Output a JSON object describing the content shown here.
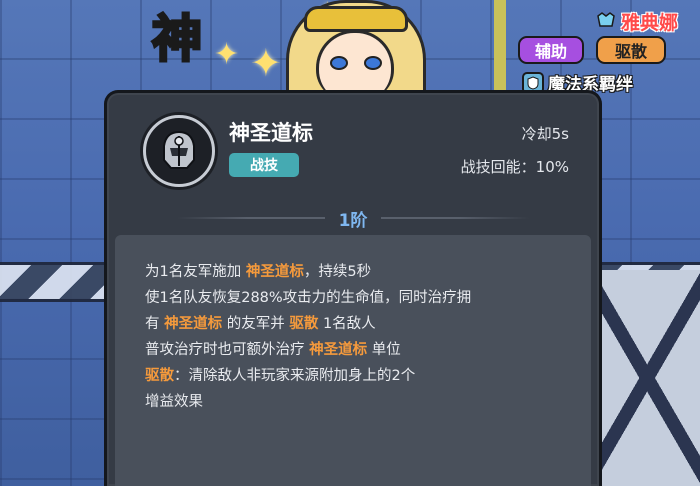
{
  "background": {
    "big_char": "神"
  },
  "header": {
    "hero_name": "雅典娜",
    "tags": [
      "辅助",
      "驱散"
    ],
    "bond": "魔法系羁绊",
    "icon": "crest-icon"
  },
  "skill": {
    "name": "神圣道标",
    "type": "战技",
    "cooldown": "冷却5s",
    "energy": "战技回能：10%",
    "tier": "1阶",
    "icon": "helmet-emblem-icon"
  },
  "description": {
    "line1": {
      "a": "为1名友军施加",
      "kw1": "神圣道标",
      "b": "，持续5秒"
    },
    "line2": {
      "a": "使1名队友恢复288%攻击力的生命值，同时治疗拥"
    },
    "line3": {
      "a": "有",
      "kw1": "神圣道标",
      "b": "的友军并",
      "kw2": "驱散",
      "c": "1名敌人"
    },
    "line4": {
      "a": "普攻治疗时也可额外治疗",
      "kw1": "神圣道标",
      "b": "单位"
    },
    "line5": {
      "kw1": "驱散",
      "a": "：清除敌人非玩家来源附加身上的2个"
    },
    "line6": {
      "a": "增益效果"
    }
  },
  "colors": {
    "keyword": "#f59a3c",
    "tier": "#7fb7f0",
    "type_badge": "#45aab2",
    "support_tag": "#a64fe0",
    "dispel_tag": "#f0a04a",
    "hero_name": "#ff4a4a"
  }
}
